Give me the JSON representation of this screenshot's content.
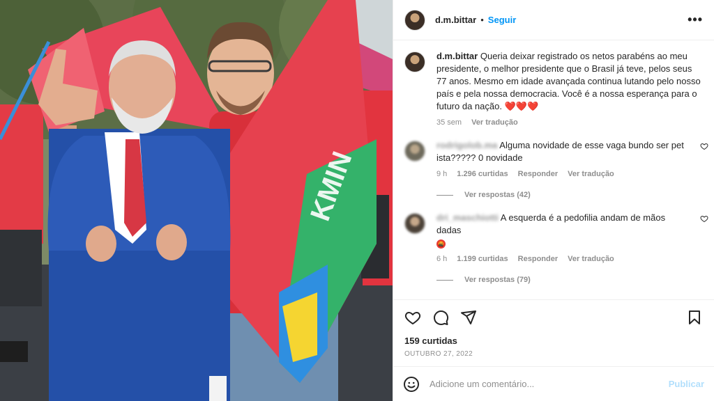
{
  "post": {
    "username": "d.m.bittar",
    "follow_label": "Seguir",
    "separator": "•",
    "more_label": "•••",
    "caption_text": "Queria deixar registrado os netos parabéns ao meu presidente, o melhor presidente que o Brasil já teve, pelos seus 77 anos. Mesmo em idade avançada continua lutando pelo nosso país e pela nossa democracia. Você é a nossa esperança para o futuro da nação.",
    "caption_hearts": "❤️❤️❤️",
    "caption_time": "35 sem",
    "caption_translate": "Ver tradução"
  },
  "comments": [
    {
      "username": "rodrigolob.ma",
      "text": "Alguma novidade de esse vaga bundo ser pet ista????? 0 novidade",
      "time": "9 h",
      "likes": "1.296 curtidas",
      "reply_label": "Responder",
      "translate_label": "Ver tradução",
      "view_replies": "Ver respostas (42)"
    },
    {
      "username": "dri_maschiotti",
      "text": "A esquerda é a pedofilia andam de mãos dadas",
      "emoji": "🤬",
      "time": "6 h",
      "likes": "1.199 curtidas",
      "reply_label": "Responder",
      "translate_label": "Ver tradução",
      "view_replies": "Ver respostas (79)"
    }
  ],
  "footer": {
    "likes": "159 curtidas",
    "date": "OUTUBRO 27, 2022",
    "comment_placeholder": "Adicione um comentário...",
    "publish_label": "Publicar"
  },
  "icons": {
    "like": "heart-icon",
    "comment": "comment-icon",
    "share": "paper-plane-icon",
    "save": "bookmark-icon",
    "emoji": "smiley-icon"
  },
  "colors": {
    "link_blue": "#0095f6",
    "publish_disabled": "#b2dffc",
    "muted": "#8e8e8e"
  }
}
